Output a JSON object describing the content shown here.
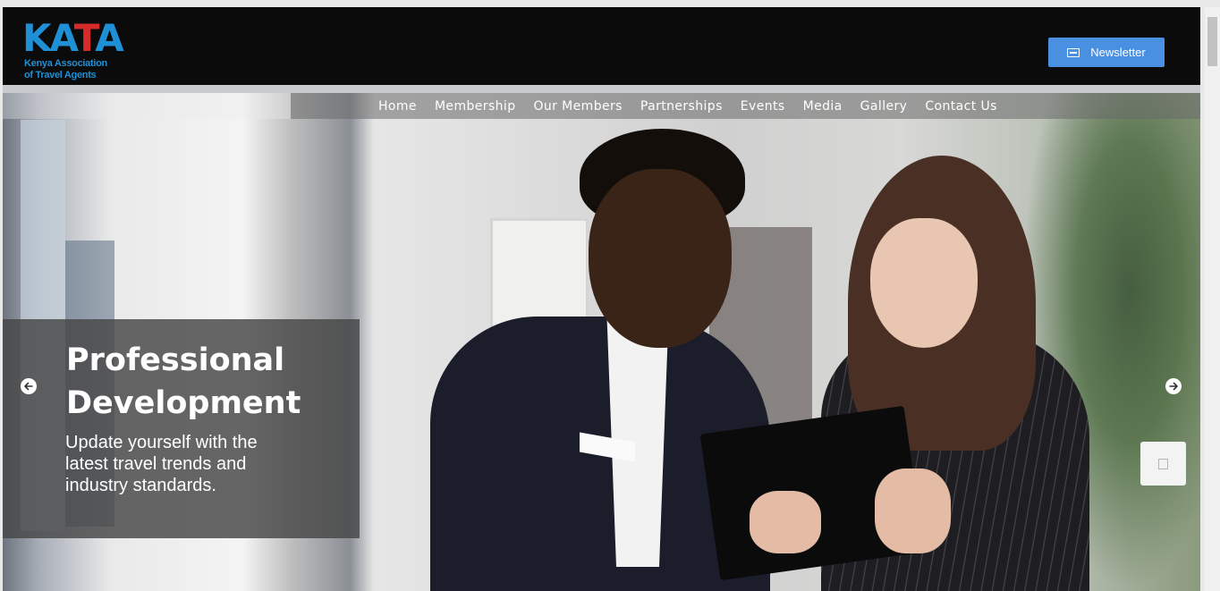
{
  "header": {
    "logo_text_part1": "KA",
    "logo_text_part2": "T",
    "logo_text_part3": "A",
    "logo_line1": "Kenya Association",
    "logo_line2": "of Travel Agents",
    "newsletter_label": "Newsletter",
    "newsletter_icon": "newsletter-icon"
  },
  "nav": {
    "items": [
      {
        "label": "Home"
      },
      {
        "label": "Membership"
      },
      {
        "label": "Our Members"
      },
      {
        "label": "Partnerships"
      },
      {
        "label": "Events"
      },
      {
        "label": "Media"
      },
      {
        "label": "Gallery"
      },
      {
        "label": "Contact Us"
      }
    ]
  },
  "slide": {
    "title_line1": "Professional",
    "title_line2": "Development",
    "text": "Update yourself with the latest travel trends and industry standards.",
    "prev_icon": "arrow-left-icon",
    "next_icon": "arrow-right-icon"
  },
  "colors": {
    "header_bg": "#0b0b0b",
    "brand_blue": "#1f8fd6",
    "brand_red": "#d62b2b",
    "button_blue": "#4a90e2"
  }
}
